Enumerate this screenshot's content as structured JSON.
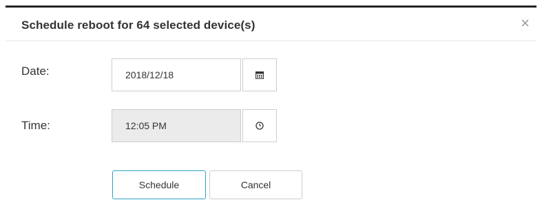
{
  "dialog": {
    "title": "Schedule reboot for 64 selected device(s)",
    "close_glyph": "×"
  },
  "date": {
    "label": "Date:",
    "value": "2018/12/18",
    "icon": "calendar-icon"
  },
  "time": {
    "label": "Time:",
    "value": "12:05 PM",
    "icon": "clock-icon",
    "disabled": true
  },
  "actions": {
    "schedule_label": "Schedule",
    "cancel_label": "Cancel"
  },
  "colors": {
    "primary_border": "#2aa3c5",
    "disabled_bg": "#ebebeb"
  }
}
